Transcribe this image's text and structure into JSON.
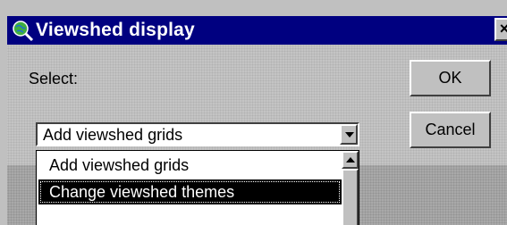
{
  "window": {
    "title": "Viewshed display",
    "icon": "magnifier-globe-icon",
    "close_glyph": "×"
  },
  "form": {
    "select_label": "Select:",
    "ok_label": "OK",
    "cancel_label": "Cancel"
  },
  "combo": {
    "value": "Add viewshed grids",
    "options": [
      {
        "label": "Add viewshed grids",
        "selected": false
      },
      {
        "label": "Change viewshed themes",
        "selected": true
      },
      {
        "label": "",
        "selected": false
      }
    ]
  },
  "colors": {
    "titlebar": "#000080",
    "highlight": "#000000"
  }
}
